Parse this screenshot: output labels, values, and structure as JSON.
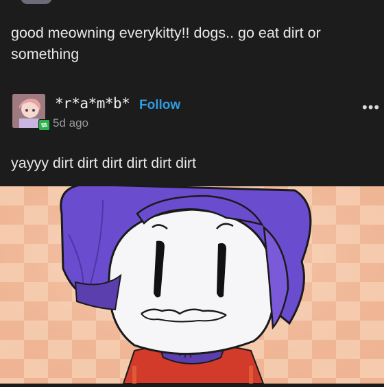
{
  "post": {
    "text": "good meowning everykitty!! dogs.. go eat dirt or something"
  },
  "reply": {
    "username": "*r*a*m*b*",
    "follow_label": "Follow",
    "time_ago": "5d ago",
    "text": "yayyy dirt dirt dirt dirt dirt dirt",
    "more_icon": "more-horizontal-icon"
  },
  "colors": {
    "background": "#1c1c1c",
    "follow": "#2f9be0",
    "badge": "#2bb24c",
    "hair": "#6a4ccf",
    "shirt": "#d23a2a"
  }
}
